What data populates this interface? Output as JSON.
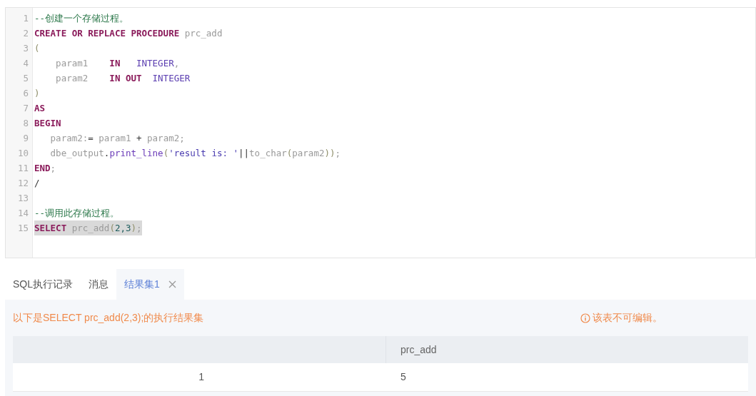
{
  "editor": {
    "lines": [
      {
        "number": "1",
        "highlighted": false,
        "tokens": [
          {
            "kind": "comment",
            "text": "--创建一个存储过程。"
          }
        ]
      },
      {
        "number": "2",
        "highlighted": false,
        "tokens": [
          {
            "kind": "keyword",
            "text": "CREATE OR REPLACE PROCEDURE"
          },
          {
            "kind": "ident",
            "text": " prc_add"
          }
        ]
      },
      {
        "number": "3",
        "highlighted": false,
        "tokens": [
          {
            "kind": "paren",
            "text": "("
          }
        ]
      },
      {
        "number": "4",
        "highlighted": false,
        "tokens": [
          {
            "kind": "ident",
            "text": "    param1    "
          },
          {
            "kind": "keyword",
            "text": "IN"
          },
          {
            "kind": "type",
            "text": "   INTEGER"
          },
          {
            "kind": "ident",
            "text": ","
          }
        ]
      },
      {
        "number": "5",
        "highlighted": false,
        "tokens": [
          {
            "kind": "ident",
            "text": "    param2    "
          },
          {
            "kind": "keyword",
            "text": "IN OUT"
          },
          {
            "kind": "type",
            "text": "  INTEGER"
          }
        ]
      },
      {
        "number": "6",
        "highlighted": false,
        "tokens": [
          {
            "kind": "paren",
            "text": ")"
          }
        ]
      },
      {
        "number": "7",
        "highlighted": false,
        "tokens": [
          {
            "kind": "keyword",
            "text": "AS"
          }
        ]
      },
      {
        "number": "8",
        "highlighted": false,
        "tokens": [
          {
            "kind": "keyword",
            "text": "BEGIN"
          }
        ]
      },
      {
        "number": "9",
        "highlighted": false,
        "tokens": [
          {
            "kind": "ident",
            "text": "   param2:"
          },
          {
            "kind": "operator",
            "text": "="
          },
          {
            "kind": "ident",
            "text": " param1 "
          },
          {
            "kind": "operator",
            "text": "+"
          },
          {
            "kind": "ident",
            "text": " param2;"
          }
        ]
      },
      {
        "number": "10",
        "highlighted": false,
        "tokens": [
          {
            "kind": "ident",
            "text": "   dbe_output"
          },
          {
            "kind": "operator",
            "text": "."
          },
          {
            "kind": "func",
            "text": "print_line"
          },
          {
            "kind": "paren",
            "text": "("
          },
          {
            "kind": "string",
            "text": "'result is: '"
          },
          {
            "kind": "operator",
            "text": "||"
          },
          {
            "kind": "ident",
            "text": "to_char"
          },
          {
            "kind": "paren",
            "text": "("
          },
          {
            "kind": "ident",
            "text": "param2"
          },
          {
            "kind": "paren",
            "text": "))"
          },
          {
            "kind": "ident",
            "text": ";"
          }
        ]
      },
      {
        "number": "11",
        "highlighted": false,
        "tokens": [
          {
            "kind": "keyword",
            "text": "END"
          },
          {
            "kind": "ident",
            "text": ";"
          }
        ]
      },
      {
        "number": "12",
        "highlighted": false,
        "tokens": [
          {
            "kind": "operator",
            "text": "/"
          }
        ]
      },
      {
        "number": "13"
      },
      {
        "number": "14",
        "highlighted": false,
        "tokens": [
          {
            "kind": "comment",
            "text": "--调用此存储过程。"
          }
        ]
      },
      {
        "number": "15",
        "highlighted": true,
        "tokens": [
          {
            "kind": "keyword",
            "text": "SELECT"
          },
          {
            "kind": "ident",
            "text": " prc_add"
          },
          {
            "kind": "paren",
            "text": "("
          },
          {
            "kind": "number",
            "text": "2,3"
          },
          {
            "kind": "paren",
            "text": ")"
          },
          {
            "kind": "ident",
            "text": ";"
          }
        ]
      }
    ]
  },
  "tabs": [
    {
      "label": "SQL执行记录",
      "selected": false,
      "closable": false
    },
    {
      "label": "消息",
      "selected": false,
      "closable": false
    },
    {
      "label": "结果集1",
      "selected": true,
      "closable": true
    }
  ],
  "result": {
    "message": "以下是SELECT prc_add(2,3);的执行结果集",
    "notice": "该表不可编辑。",
    "table": {
      "columns": [
        "",
        "prc_add"
      ],
      "rows": [
        [
          "1",
          "5"
        ]
      ]
    }
  }
}
